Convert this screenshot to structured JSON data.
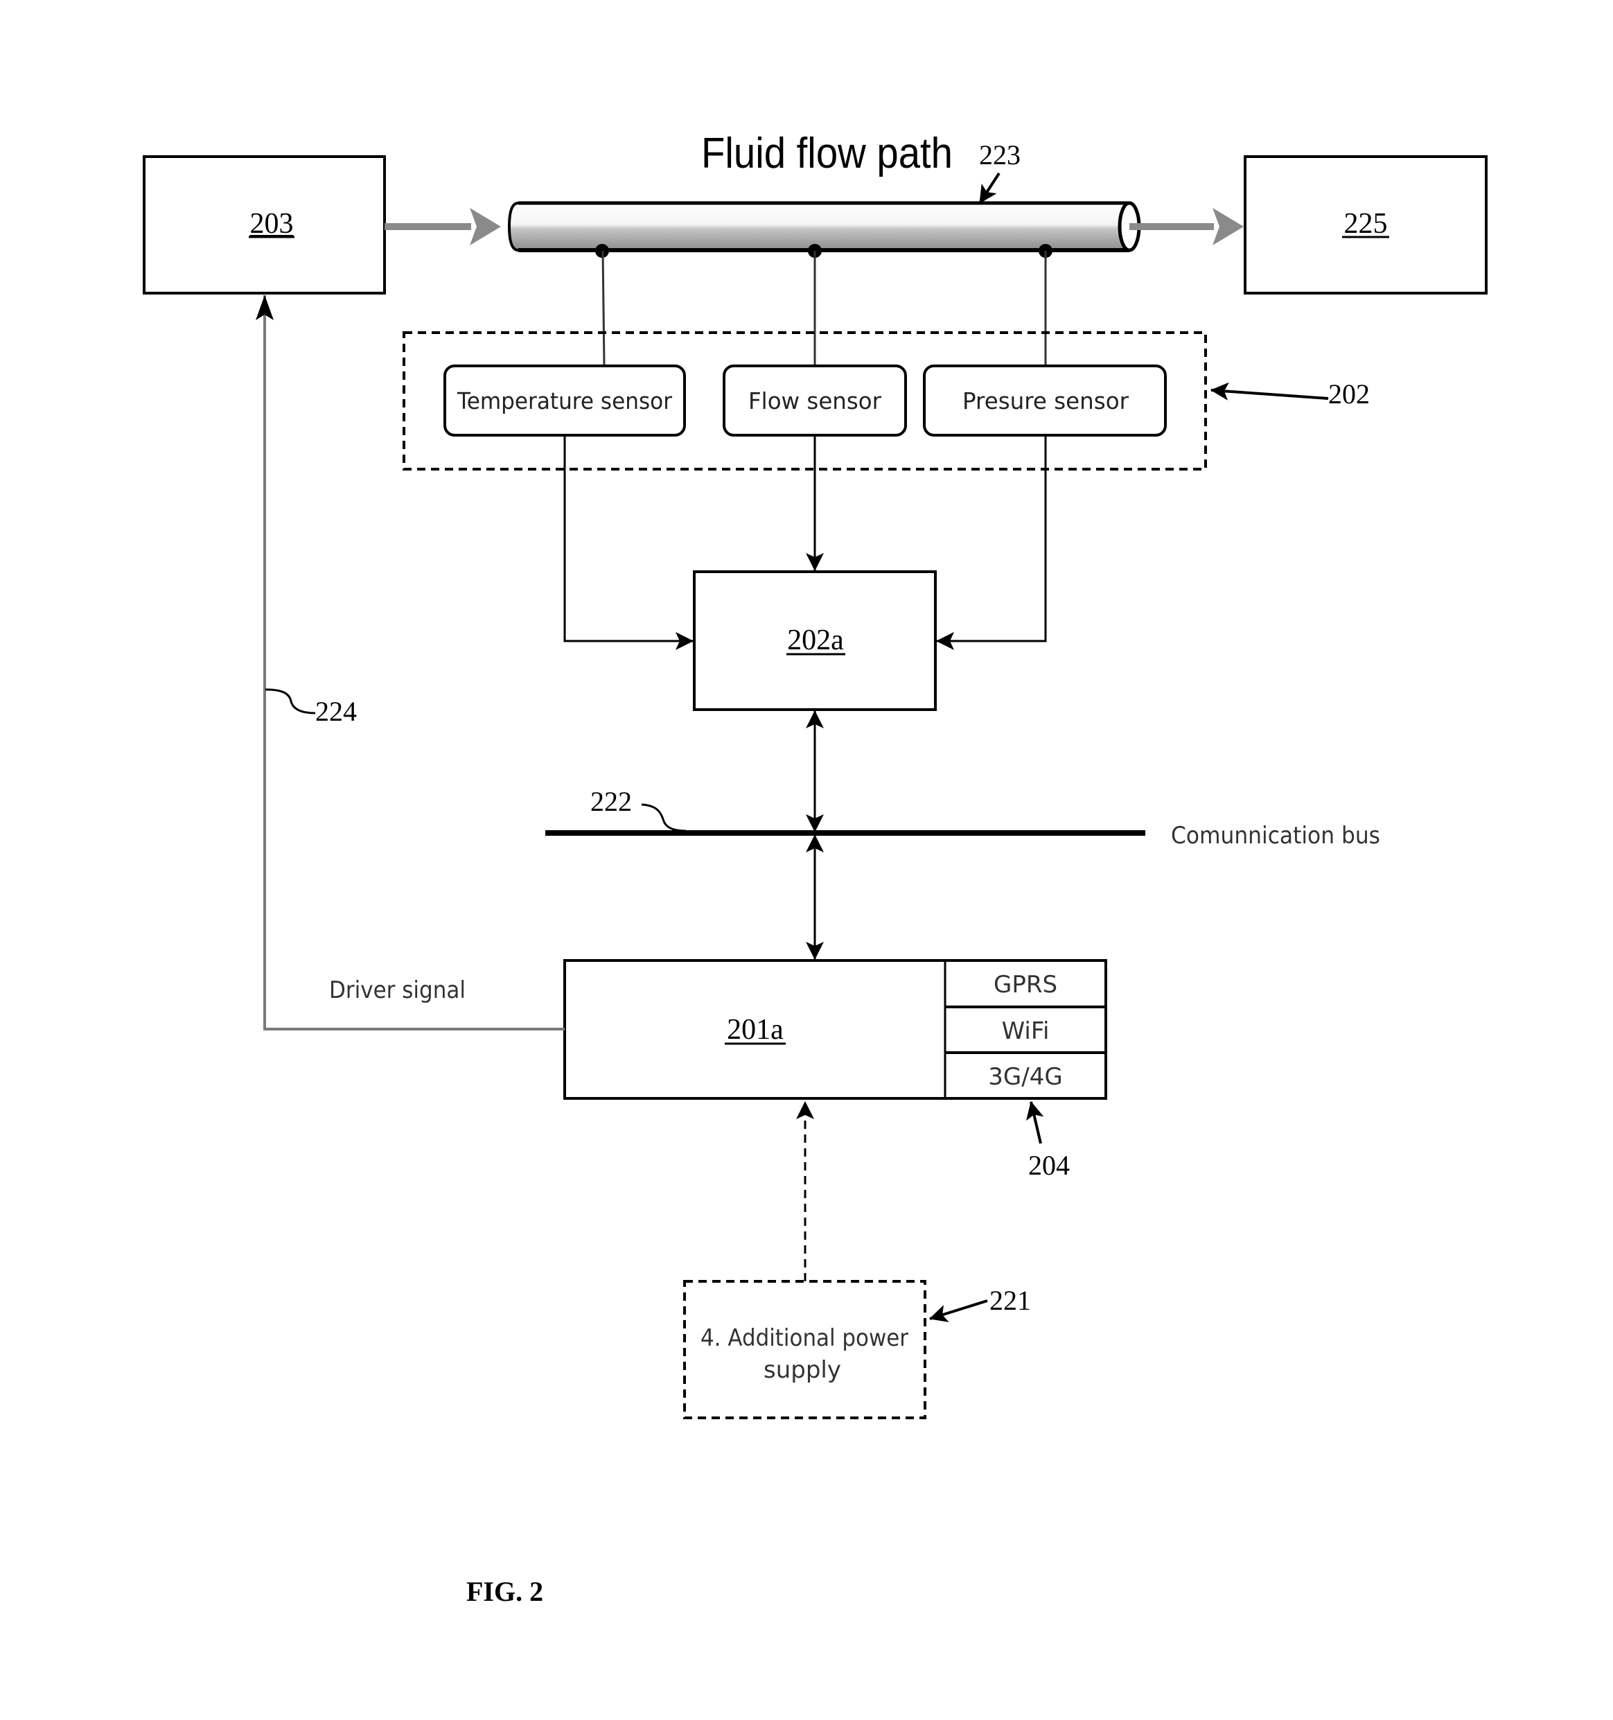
{
  "figure": {
    "caption": "FIG. 2",
    "title": "Fluid flow path",
    "colors": {
      "line": "#000000",
      "flow_arrow": "#8a8a8a",
      "feedback_line": "#7a7a7a",
      "pipe_shade": "#9a9a9a"
    }
  },
  "blocks": {
    "source": {
      "ref": "203"
    },
    "sink": {
      "ref": "225"
    },
    "sensor_processor": {
      "ref": "202a"
    },
    "controller": {
      "ref": "201a"
    },
    "power_supply": {
      "line1": "4. Additional power",
      "line2": "supply"
    }
  },
  "sensors": [
    {
      "label": "Temperature sensor"
    },
    {
      "label": "Flow sensor"
    },
    {
      "label": "Presure sensor"
    }
  ],
  "comm_modules": [
    {
      "label": "GPRS"
    },
    {
      "label": "WiFi"
    },
    {
      "label": "3G/4G"
    }
  ],
  "bus": {
    "label": "Comunnication bus"
  },
  "signals": {
    "driver": "Driver signal"
  },
  "reference_numerals": {
    "pipe": "223",
    "sensor_group": "202",
    "bus": "222",
    "feedback": "224",
    "comm": "204",
    "power": "221"
  }
}
